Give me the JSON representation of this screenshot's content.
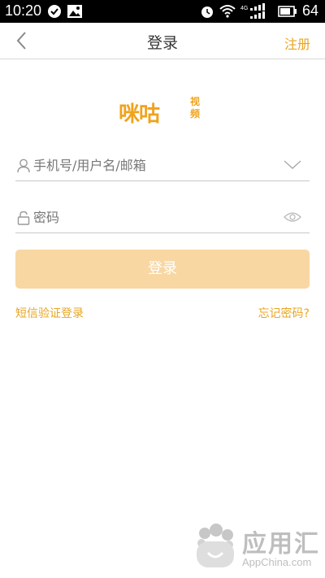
{
  "status_bar": {
    "time": "10:20",
    "battery": "64",
    "network": "4G",
    "icons": [
      "check-circle-icon",
      "image-icon",
      "alarm-icon",
      "wifi-icon",
      "signal-icon",
      "battery-icon"
    ]
  },
  "header": {
    "title": "登录",
    "register": "注册",
    "back_icon": "chevron-left-icon"
  },
  "logo": {
    "main": "咪咕",
    "sub": "视频"
  },
  "form": {
    "username_placeholder": "手机号/用户名/邮箱",
    "password_placeholder": "密码",
    "login_button": "登录",
    "sms_login": "短信验证登录",
    "forgot_password": "忘记密码?"
  },
  "watermark": {
    "text": "应用汇",
    "sub": "AppChina.com"
  },
  "colors": {
    "accent": "#e8a623",
    "button_disabled": "#f8d7a3",
    "divider": "#c8c8c8"
  }
}
